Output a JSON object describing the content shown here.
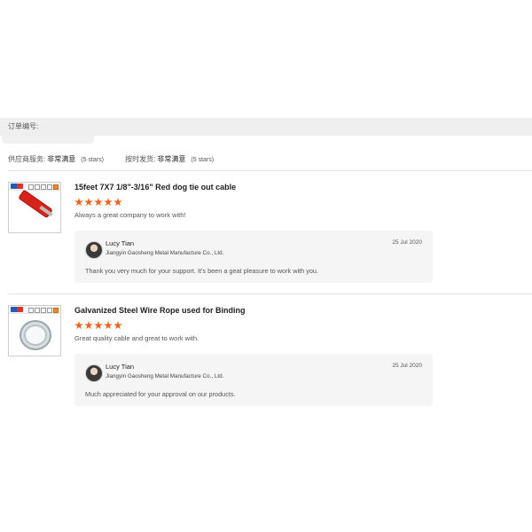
{
  "order": {
    "label": "订单编号:"
  },
  "ratings": [
    {
      "label": "供应商服务:",
      "value": "非常满意",
      "stars": "(5 stars)"
    },
    {
      "label": "按时发货:",
      "value": "非常满意",
      "stars": "(5 stars)"
    }
  ],
  "reviews": [
    {
      "product_title": "15feet 7X7 1/8\"-3/16\" Red dog tie out cable",
      "rating": 5,
      "comment": "Always a great company to work with!",
      "reply": {
        "name": "Lucy Tian",
        "company": "Jiangyin Gaosheng Metal Manufacture Co., Ltd.",
        "date": "25 Jul 2020",
        "text": "Thank you very much for your support. It's been a geat pleasure to work with you."
      }
    },
    {
      "product_title": "Galvanized Steel Wire Rope used for Binding",
      "rating": 5,
      "comment": "Great quality cable and great to work with.",
      "reply": {
        "name": "Lucy Tian",
        "company": "Jiangyin Gaosheng Metal Manufacture Co., Ltd.",
        "date": "25 Jul 2020",
        "text": "Much appreciated for your approval on our products."
      }
    }
  ],
  "colors": {
    "star": "#f0621f",
    "reply_bg": "#f5f5f5",
    "order_bar": "#efefef"
  },
  "icons": [
    "star-icon",
    "avatar-icon",
    "product-thumbnail"
  ]
}
